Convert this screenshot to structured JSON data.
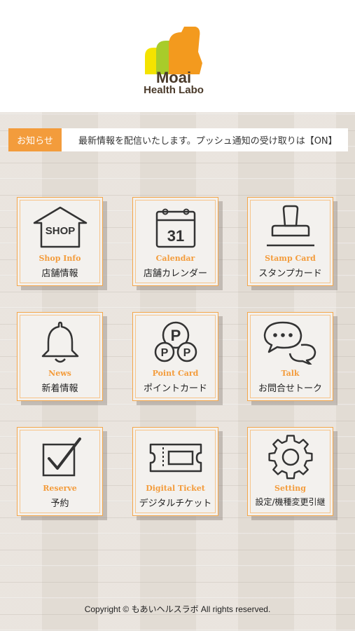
{
  "header": {
    "logo_main": "Moai",
    "logo_sub": "Health Labo"
  },
  "notice": {
    "badge": "お知らせ",
    "text": "最新情報を配信いたします。プッシュ通知の受け取りは【ON】"
  },
  "menu": [
    {
      "en": "Shop Info",
      "jp": "店舗情報",
      "icon": "shop-icon",
      "icon_text": "SHOP"
    },
    {
      "en": "Calendar",
      "jp": "店舗カレンダー",
      "icon": "calendar-icon",
      "icon_text": "31"
    },
    {
      "en": "Stamp Card",
      "jp": "スタンプカード",
      "icon": "stamp-icon"
    },
    {
      "en": "News",
      "jp": "新着情報",
      "icon": "bell-icon"
    },
    {
      "en": "Point Card",
      "jp": "ポイントカード",
      "icon": "point-icon",
      "icon_text": "P"
    },
    {
      "en": "Talk",
      "jp": "お問合せトーク",
      "icon": "chat-icon"
    },
    {
      "en": "Reserve",
      "jp": "予約",
      "icon": "checkbox-icon"
    },
    {
      "en": "Digital Ticket",
      "jp": "デジタルチケット",
      "icon": "ticket-icon"
    },
    {
      "en": "Setting",
      "jp": "設定/機種変更引継",
      "icon": "gear-icon"
    }
  ],
  "footer": {
    "copyright": "Copyright © もあいヘルスラボ All rights reserved."
  },
  "colors": {
    "accent": "#f39c3c",
    "tile_border": "#f4a64a",
    "icon_stroke": "#333333"
  }
}
